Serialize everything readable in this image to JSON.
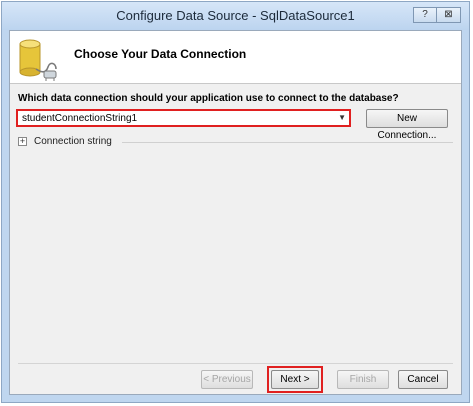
{
  "window": {
    "title": "Configure Data Source - SqlDataSource1",
    "help_button": "?",
    "close_button": "⊠"
  },
  "header": {
    "icon": "database-icon",
    "title": "Choose Your Data Connection"
  },
  "form": {
    "question": "Which data connection should your application use to connect to the database?",
    "connection_select_value": "studentConnectionString1",
    "new_connection_label": "New Connection...",
    "connection_string_toggle": "+",
    "connection_string_label": "Connection string"
  },
  "footer": {
    "previous_label": "< Previous",
    "next_label": "Next >",
    "finish_label": "Finish",
    "cancel_label": "Cancel"
  },
  "colors": {
    "highlight": "#e02020",
    "title_bar": "#c9dcf2",
    "dialog_bg": "#f0f0f0"
  }
}
